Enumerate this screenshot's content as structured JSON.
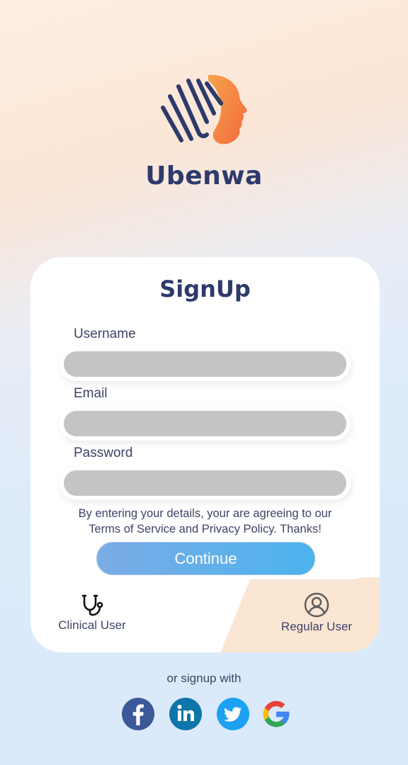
{
  "app": {
    "name": "Ubenwa"
  },
  "signup": {
    "title": "SignUp",
    "fields": [
      {
        "label": "Username",
        "value": "",
        "placeholder": ""
      },
      {
        "label": "Email",
        "value": "",
        "placeholder": ""
      },
      {
        "label": "Password",
        "value": "",
        "placeholder": ""
      }
    ],
    "terms_line1": "By entering your details, your are agreeing to our",
    "terms_line2": "Terms of Service and Privacy Policy. Thanks!",
    "continue_label": "Continue"
  },
  "user_types": {
    "clinical": {
      "label": "Clinical User",
      "icon": "stethoscope-icon"
    },
    "regular": {
      "label": "Regular User",
      "icon": "user-circle-icon",
      "selected": true
    }
  },
  "social": {
    "prompt": "or signup with",
    "providers": [
      {
        "name": "Facebook",
        "icon": "facebook-icon",
        "color": "#3b5998"
      },
      {
        "name": "LinkedIn",
        "icon": "linkedin-icon",
        "color": "#0e76a8"
      },
      {
        "name": "Twitter",
        "icon": "twitter-icon",
        "color": "#1da1f2"
      },
      {
        "name": "Google",
        "icon": "google-icon",
        "color": "#4285f4"
      }
    ]
  },
  "colors": {
    "brand_navy": "#2e3a6b",
    "accent_orange": "#f08a3c",
    "button_blue": "#4bb3ee",
    "input_gray": "#c4c4c4",
    "selected_peach": "#fbe5d3"
  }
}
